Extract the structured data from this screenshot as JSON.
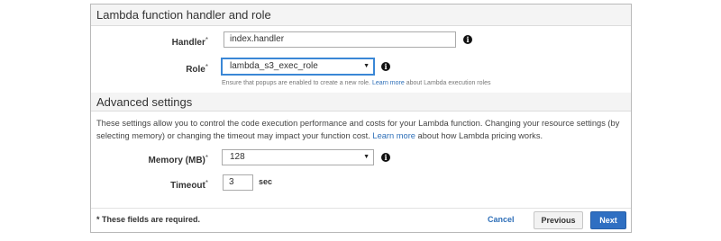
{
  "sections": {
    "handler_role_title": "Lambda function handler and role",
    "advanced_title": "Advanced settings"
  },
  "fields": {
    "handler": {
      "label": "Handler",
      "value": "index.handler"
    },
    "role": {
      "label": "Role",
      "value": "lambda_s3_exec_role"
    },
    "memory": {
      "label": "Memory (MB)",
      "value": "128"
    },
    "timeout": {
      "label": "Timeout",
      "value": "3",
      "unit": "sec"
    }
  },
  "required_marker": "*",
  "role_hint": {
    "text_before": "Ensure that popups are enabled to create a new role. ",
    "link": "Learn more",
    "text_after": " about Lambda execution roles"
  },
  "advanced_desc": {
    "text_before": "These settings allow you to control the code execution performance and costs for your Lambda function. Changing your resource settings (by selecting memory) or changing the timeout may impact your function cost. ",
    "link": "Learn more",
    "text_after": " about how Lambda pricing works."
  },
  "footer": {
    "required_note": "* These fields are required.",
    "cancel": "Cancel",
    "previous": "Previous",
    "next": "Next"
  },
  "icons": {
    "info": "i",
    "dropdown": "▼"
  },
  "colors": {
    "link": "#2e6fb8",
    "primary_button": "#2f6fc2",
    "focus_border": "#3a87d6"
  }
}
